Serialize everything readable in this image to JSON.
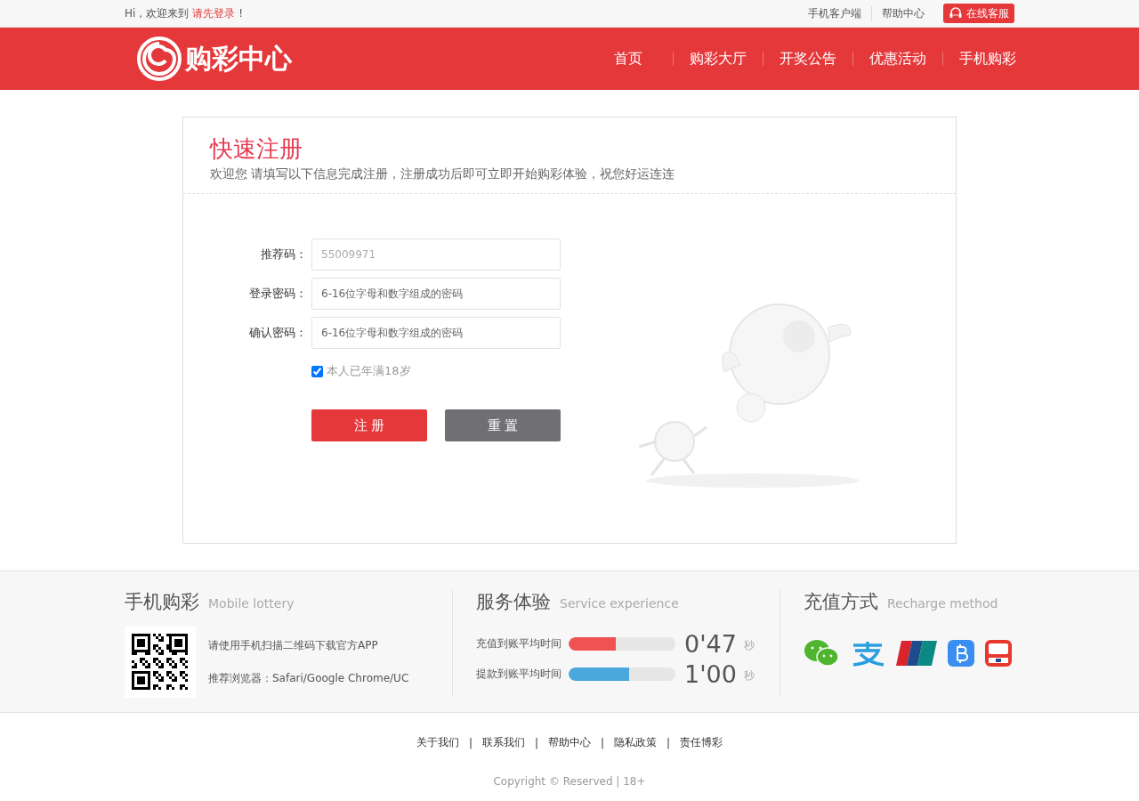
{
  "top_bar": {
    "greeting": "Hi，欢迎来到",
    "login_link": "请先登录",
    "exclamation": "!",
    "links": [
      "手机客户端",
      "帮助中心"
    ],
    "service_button": "在线客服"
  },
  "header": {
    "logo_text": "购彩中心",
    "nav": [
      "首页",
      "购彩大厅",
      "开奖公告",
      "优惠活动",
      "手机购彩"
    ]
  },
  "form": {
    "title": "快速注册",
    "subtitle": "欢迎您 请填写以下信息完成注册，注册成功后即可立即开始购彩体验，祝您好运连连",
    "fields": [
      {
        "label": "推荐码：",
        "placeholder": "55009971"
      },
      {
        "label": "登录密码：",
        "placeholder": "6-16位字母和数字组成的密码"
      },
      {
        "label": "确认密码：",
        "placeholder": "6-16位字母和数字组成的密码"
      }
    ],
    "age_check": {
      "label": "本人已年满18岁",
      "checked": true
    },
    "buttons": [
      {
        "label": "注 册",
        "kind": "primary"
      },
      {
        "label": "重 置",
        "kind": "secondary"
      }
    ]
  },
  "mobile": {
    "title": "手机购彩",
    "subtitle": "Mobile lottery",
    "lines": [
      "请使用手机扫描二维码下载官方APP",
      "推荐浏览器：Safari/Google Chrome/UC"
    ]
  },
  "service": {
    "title": "服务体验",
    "subtitle": "Service experience",
    "metrics": [
      {
        "label": "充值到账平均时间",
        "level": 0.44,
        "color": "#f05252",
        "value": "0'47",
        "unit": "秒"
      },
      {
        "label": "提款到账平均时间",
        "level": 0.57,
        "color": "#4aa8dc",
        "value": "1'00",
        "unit": "秒"
      }
    ]
  },
  "recharge": {
    "title": "充值方式",
    "subtitle": "Recharge method"
  },
  "footer_links": [
    "关于我们",
    "联系我们",
    "帮助中心",
    "隐私政策",
    "责任博彩"
  ],
  "footer_separators": [
    "|",
    "|",
    "|",
    "|"
  ],
  "copyright": "Copyright © Reserved | 18+"
}
